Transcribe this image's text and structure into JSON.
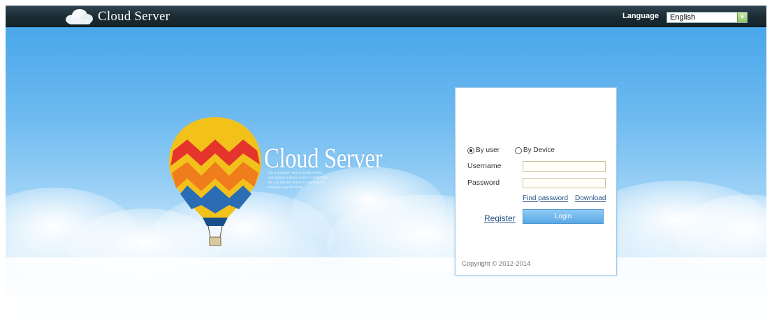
{
  "header": {
    "brand": "Cloud Server",
    "language_label": "Language",
    "language_value": "English",
    "accent_color": "#1b2b33"
  },
  "hero": {
    "title": "Cloud Server",
    "note_lines": [
      "The IE Explorer need to install ActiveX.",
      "And another Explorer need to install Plugin.",
      "You can click the button to download the",
      "Package or by CD-ROM."
    ]
  },
  "login": {
    "mode_options": [
      "By user",
      "By Device"
    ],
    "selected_mode": "By user",
    "username_label": "Username",
    "username_value": "",
    "password_label": "Password",
    "password_value": "",
    "find_password": "Find password",
    "download": "Download",
    "register": "Register",
    "login_button": "Login",
    "copyright": "Copyright © 2012-2014"
  },
  "icons": {
    "brand": "cloud-icon",
    "language_select": "chevron-down-icon",
    "hero_image": "hot-air-balloon-icon"
  }
}
